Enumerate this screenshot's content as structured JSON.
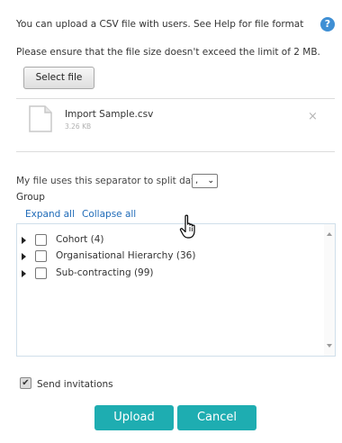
{
  "intro": {
    "info_text": "You can upload a CSV file with users. See Help for file format",
    "help_icon": "?",
    "size_notice": "Please ensure that the file size doesn't exceed the limit of 2 MB."
  },
  "select_file": {
    "label": "Select file"
  },
  "selected_file": {
    "name": "Import Sample.csv",
    "size": "3.26 KB",
    "remove_icon": "×"
  },
  "separator": {
    "label": "My file uses this separator to split data",
    "value": ",",
    "chevron": "⌄"
  },
  "group": {
    "label": "Group",
    "expand_all": "Expand all",
    "collapse_all": "Collapse all",
    "items": [
      {
        "label": "Cohort (4)",
        "checked": false
      },
      {
        "label": "Organisational Hierarchy (36)",
        "checked": false
      },
      {
        "label": "Sub-contracting (99)",
        "checked": false
      }
    ]
  },
  "invitations": {
    "label": "Send invitations",
    "checked": true,
    "check_mark": "✔"
  },
  "actions": {
    "upload": "Upload",
    "cancel": "Cancel"
  },
  "colors": {
    "primary_button": "#1eadb1",
    "link": "#1f6bb8",
    "help_icon": "#3f8fd4"
  }
}
